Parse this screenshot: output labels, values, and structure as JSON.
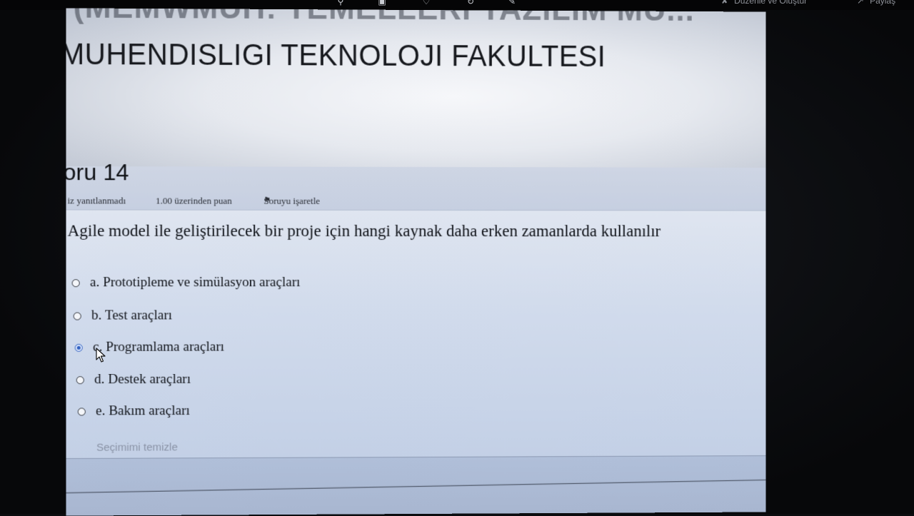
{
  "topbar": {
    "edit_label": "Düzenle ve Oluştur",
    "share_label": "Paylaş",
    "icons": [
      "search-icon",
      "delete-icon",
      "favorite-icon",
      "rotate-icon",
      "crop-icon"
    ]
  },
  "course": {
    "title_line1": "(MEMWMUH: TEMELLERI YAZILIM MÜ...",
    "title_line2": "MUHENDISLIGI TEKNOLOJI FAKULTESI"
  },
  "question": {
    "number_label": "oru 14",
    "status": "iz yanıtlanmadı",
    "points": "1.00 üzerinden puan",
    "flag_label": "Soruyu işaretle",
    "text": "Agile model ile geliştirilecek bir proje için hangi kaynak daha erken zamanlarda kullanılır",
    "options": [
      {
        "label": "a. Prototipleme ve simülasyon araçları",
        "selected": false
      },
      {
        "label": "b. Test araçları",
        "selected": false
      },
      {
        "label": "c. Programlama araçları",
        "selected": true
      },
      {
        "label": "d. Destek araçları",
        "selected": false
      },
      {
        "label": "e. Bakım araçları",
        "selected": false
      }
    ],
    "clear_label": "Seçimimi temizle"
  },
  "colors": {
    "selected_radio": "#2f5fc0",
    "page_text": "#12151b"
  }
}
